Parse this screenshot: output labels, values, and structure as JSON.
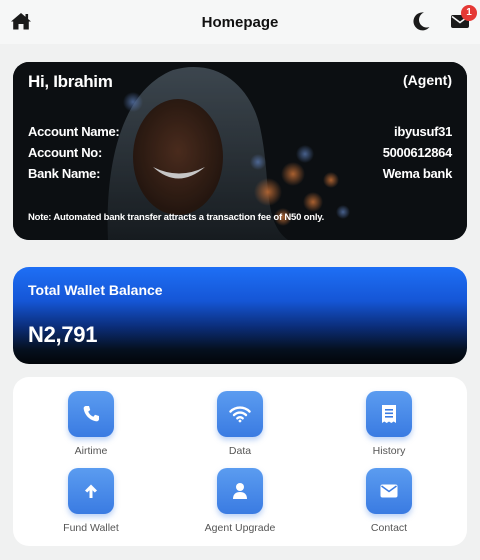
{
  "header": {
    "title": "Homepage",
    "notification_count": "1",
    "icons": {
      "home": "home-icon",
      "theme": "moon-icon",
      "messages": "envelope-icon"
    }
  },
  "account": {
    "greeting": "Hi, Ibrahim",
    "role": "(Agent)",
    "rows": [
      {
        "label": "Account Name:",
        "value": "ibyusuf31"
      },
      {
        "label": "Account No:",
        "value": "5000612864"
      },
      {
        "label": "Bank Name:",
        "value": "Wema bank"
      }
    ],
    "note": "Note: Automated bank transfer attracts a transaction fee of N50 only."
  },
  "wallet": {
    "label": "Total Wallet Balance",
    "amount": "N2,791"
  },
  "services": [
    {
      "label": "Airtime",
      "icon": "phone-icon"
    },
    {
      "label": "Data",
      "icon": "wifi-icon"
    },
    {
      "label": "History",
      "icon": "receipt-icon"
    },
    {
      "label": "Fund Wallet",
      "icon": "arrow-up-icon"
    },
    {
      "label": "Agent Upgrade",
      "icon": "user-icon"
    },
    {
      "label": "Contact",
      "icon": "envelope-icon"
    }
  ],
  "colors": {
    "accent": "#3a7be2",
    "wallet_top": "#1e6ff5",
    "badge": "#e53935",
    "background": "#f0f1f1"
  }
}
